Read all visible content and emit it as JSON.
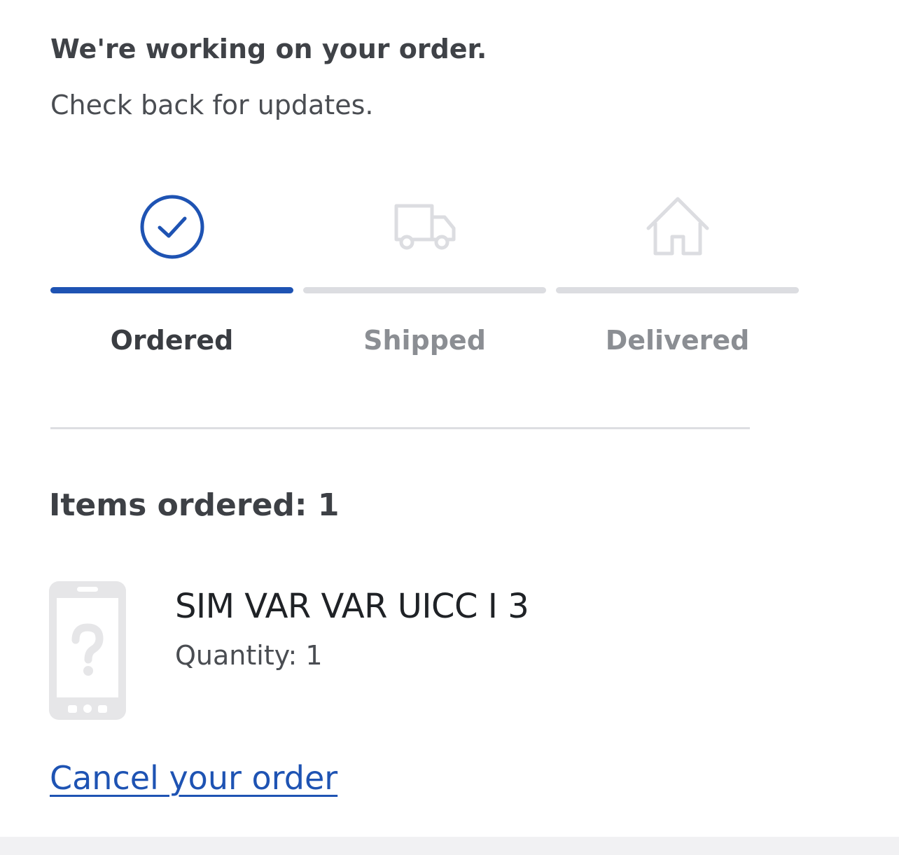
{
  "status": {
    "headline": "We're working on your order.",
    "subline": "Check back for updates."
  },
  "tracker": {
    "steps": [
      {
        "label": "Ordered",
        "icon": "check-circle-icon",
        "state": "complete"
      },
      {
        "label": "Shipped",
        "icon": "truck-icon",
        "state": "pending"
      },
      {
        "label": "Delivered",
        "icon": "house-icon",
        "state": "pending"
      }
    ]
  },
  "items": {
    "heading": "Items ordered: 1",
    "list": [
      {
        "name": "SIM VAR VAR UICC I 3",
        "quantity": "Quantity: 1",
        "image": "phone-placeholder-icon"
      }
    ]
  },
  "actions": {
    "cancel_label": "Cancel your order"
  },
  "colors": {
    "accent": "#1e53b3",
    "inactive": "#dcdde1",
    "text_primary": "#3a3d42",
    "text_muted": "#8b8e93"
  }
}
